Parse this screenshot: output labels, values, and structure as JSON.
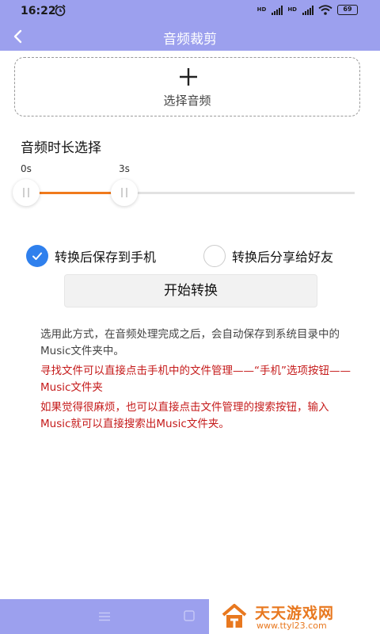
{
  "status_bar": {
    "time": "16:22",
    "signal_label_1": "HD",
    "signal_label_2": "HD",
    "battery": "69"
  },
  "header": {
    "title": "音频裁剪",
    "back_icon": "chevron-left-icon"
  },
  "select_audio": {
    "icon": "plus-icon",
    "label": "选择音频"
  },
  "duration": {
    "title": "音频时长选择",
    "start_label": "0s",
    "end_label": "3s",
    "accent_color": "#f07a1c"
  },
  "options": [
    {
      "label": "转换后保存到手机",
      "checked": true
    },
    {
      "label": "转换后分享给好友",
      "checked": false
    }
  ],
  "start_button": {
    "label": "开始转换"
  },
  "info": {
    "note": "选用此方式，在音频处理完成之后，会自动保存到系统目录中的Music文件夹中。",
    "tip_1": "寻找文件可以直接点击手机中的文件管理——“手机”选项按钮——Music文件夹",
    "tip_2": "如果觉得很麻烦，也可以直接点击文件管理的搜索按钮，输入Music就可以直接搜索出Music文件夹。",
    "tip_color": "#c51a1a"
  },
  "watermark": {
    "name": "天天游戏网",
    "url": "www.ttyl23.com"
  },
  "theme": {
    "primary": "#9ca0ee",
    "checkbox": "#2f80ed"
  }
}
